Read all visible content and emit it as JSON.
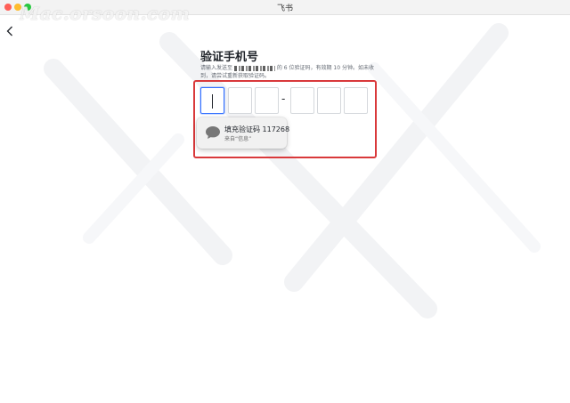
{
  "window": {
    "title": "飞书"
  },
  "watermark": "Mac.orsoon.com",
  "page": {
    "heading": "验证手机号",
    "desc_before": "请输入发送至",
    "desc_after": "的 6 位验证码，有效期 10 分钟。如未收到，请尝试重新获取验证码。"
  },
  "code_inputs": [
    "",
    "",
    "",
    "",
    "",
    ""
  ],
  "separator": "-",
  "autofill": {
    "title": "填充验证码 117268",
    "subtitle": "来自“信息”"
  },
  "colors": {
    "accent": "#3370ff",
    "highlight": "#d9393b"
  },
  "icons": {
    "back": "chevron-left-icon",
    "message": "message-bubble-icon"
  }
}
